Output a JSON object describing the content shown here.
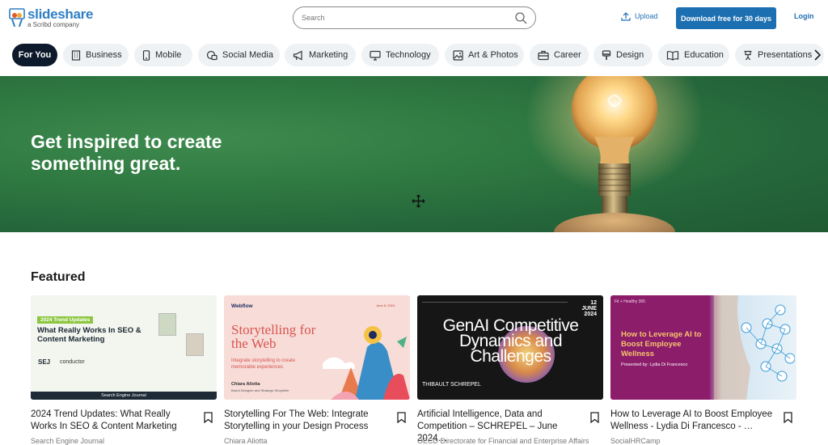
{
  "header": {
    "logo_name": "slideshare",
    "logo_sub": "a Scribd company",
    "search_placeholder": "Search",
    "upload_label": "Upload",
    "cta_label": "Download free for 30 days",
    "login_label": "Login"
  },
  "categories": [
    {
      "label": "For You",
      "icon": "none"
    },
    {
      "label": "Business",
      "icon": "building-icon"
    },
    {
      "label": "Mobile",
      "icon": "phone-icon"
    },
    {
      "label": "Social Media",
      "icon": "chat-icon"
    },
    {
      "label": "Marketing",
      "icon": "megaphone-icon"
    },
    {
      "label": "Technology",
      "icon": "monitor-icon"
    },
    {
      "label": "Art & Photos",
      "icon": "image-icon"
    },
    {
      "label": "Career",
      "icon": "briefcase-icon"
    },
    {
      "label": "Design",
      "icon": "brush-icon"
    },
    {
      "label": "Education",
      "icon": "book-icon"
    },
    {
      "label": "Presentations",
      "icon": "easel-icon"
    }
  ],
  "hero": {
    "title": "Get inspired to create something great."
  },
  "featured": {
    "heading": "Featured",
    "cards": [
      {
        "title": "2024 Trend Updates: What Really Works In SEO & Content Marketing",
        "author": "Search Engine Journal",
        "thumb": {
          "tag": "2024 Trend Updates",
          "headline": "What Really Works In SEO & Content Marketing",
          "brand1": "SEJ",
          "brand2": "conductor",
          "footer": "Search Engine Journal"
        }
      },
      {
        "title": "Storytelling For The Web: Integrate Storytelling in your Design Process",
        "author": "Chiara Aliotta",
        "thumb": {
          "brand": "Webflow",
          "headline": "Storytelling for the Web",
          "sub": "Integrate storytelling to create memorable experiences",
          "name": "Chiara Aliotta",
          "role": "Brand Designer and Strategic Storyteller",
          "date": "June 5, 2024"
        }
      },
      {
        "title": "Artificial Intelligence, Data and Competition – SCHREPEL – June 2024…",
        "author": "OECD Directorate for Financial and Enterprise Affairs",
        "thumb": {
          "headline": "GenAI Competitive Dynamics and Challenges",
          "day": "12",
          "month": "JUNE",
          "year": "2024",
          "name": "THIBAULT SCHREPEL"
        }
      },
      {
        "title": "How to Leverage AI to Boost Employee Wellness - Lydia Di Francesco - …",
        "author": "SocialHRCamp",
        "thumb": {
          "brand": "Fit + Healthy 365",
          "headline": "How to Leverage AI to Boost Employee Wellness",
          "sub": "Presented by: Lydia Di Francesco"
        }
      }
    ]
  }
}
